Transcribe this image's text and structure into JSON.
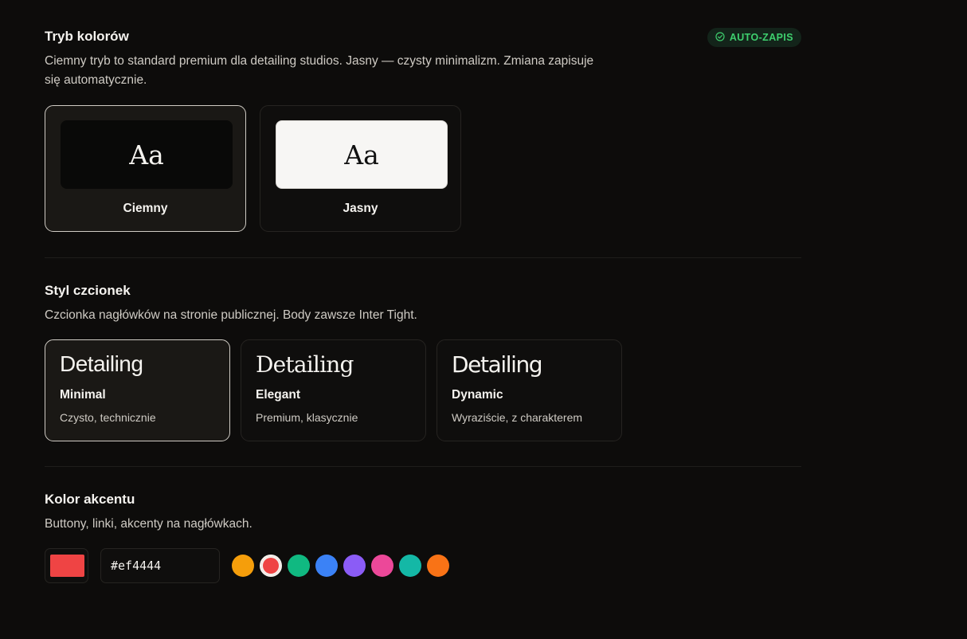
{
  "color_mode": {
    "title": "Tryb kolorów",
    "description": "Ciemny tryb to standard premium dla detailing studios. Jasny — czysty minimalizm. Zmiana zapisuje się automatycznie.",
    "badge": "AUTO-ZAPIS",
    "options": [
      {
        "preview": "Aa",
        "label": "Ciemny",
        "selected": true
      },
      {
        "preview": "Aa",
        "label": "Jasny",
        "selected": false
      }
    ]
  },
  "font_style": {
    "title": "Styl czcionek",
    "description": "Czcionka nagłówków na stronie publicznej. Body zawsze Inter Tight.",
    "options": [
      {
        "sample": "Detailing",
        "name": "Minimal",
        "subtitle": "Czysto, technicznie",
        "selected": true
      },
      {
        "sample": "Detailing",
        "name": "Elegant",
        "subtitle": "Premium, klasycznie",
        "selected": false
      },
      {
        "sample": "Detailing",
        "name": "Dynamic",
        "subtitle": "Wyraziście, z charakterem",
        "selected": false
      }
    ]
  },
  "accent": {
    "title": "Kolor akcentu",
    "description": "Buttony, linki, akcenty na nagłówkach.",
    "value": "#ef4444",
    "presets": [
      "#f59e0b",
      "#ef4444",
      "#10b981",
      "#3b82f6",
      "#8b5cf6",
      "#ec4899",
      "#14b8a6",
      "#f97316"
    ],
    "active_preset": "#ef4444"
  },
  "colors": {
    "badge_text": "#3ecf6e",
    "badge_bg": "#13241a"
  }
}
